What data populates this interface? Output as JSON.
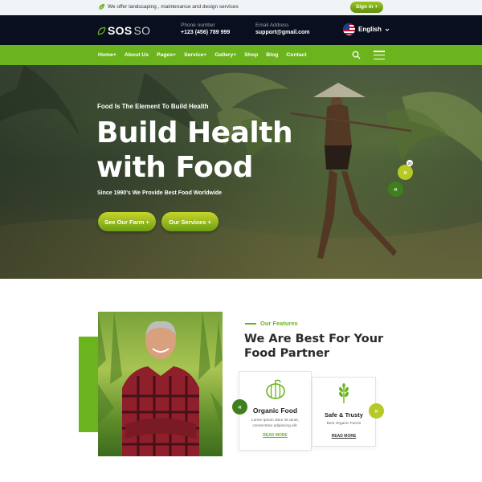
{
  "topbar": {
    "message": "We offer landscaping , maintenance and design services",
    "signin_label": "Sign in +"
  },
  "header": {
    "logo_part1": "SOS",
    "logo_part2": "SO",
    "phone_label": "Phone number",
    "phone_value": "+123 (456) 789 999",
    "email_label": "Email Address",
    "email_value": "support@gmail.com",
    "language": "English"
  },
  "nav": {
    "items": [
      "Home+",
      "About Us",
      "Pages+",
      "Service+",
      "Gallery+",
      "Shop",
      "Blog",
      "Contact"
    ]
  },
  "hero": {
    "eyebrow": "Food Is The Element To Build Health",
    "headline_line1": "Build Health",
    "headline_line2": "with Food",
    "subline": "Since 1990's We Provide Best Food Worldwide",
    "btn_farm": "See Our Farm +",
    "btn_services": "Our Services +",
    "next_label": "»",
    "prev_label": "«",
    "badge": "20"
  },
  "features": {
    "label": "Our Features",
    "title_line1": "We Are Best For Your",
    "title_line2": "Food Partner",
    "prev_label": "«",
    "next_label": "»",
    "cards": [
      {
        "title": "Organic Food",
        "desc_line1": "Lorem ipsum dolor sit amet,",
        "desc_line2": "consectetur adipiscing elit.",
        "more": "READ MORE",
        "icon": "pumpkin-icon"
      },
      {
        "title": "Safe & Trusty",
        "desc_line1": "Best Organic Farms",
        "more": "READ MORE",
        "icon": "wheat-icon"
      }
    ]
  },
  "colors": {
    "brand_green": "#6bb41d",
    "header_dark": "#0a0f1f",
    "accent_lime": "#c6d62b"
  }
}
